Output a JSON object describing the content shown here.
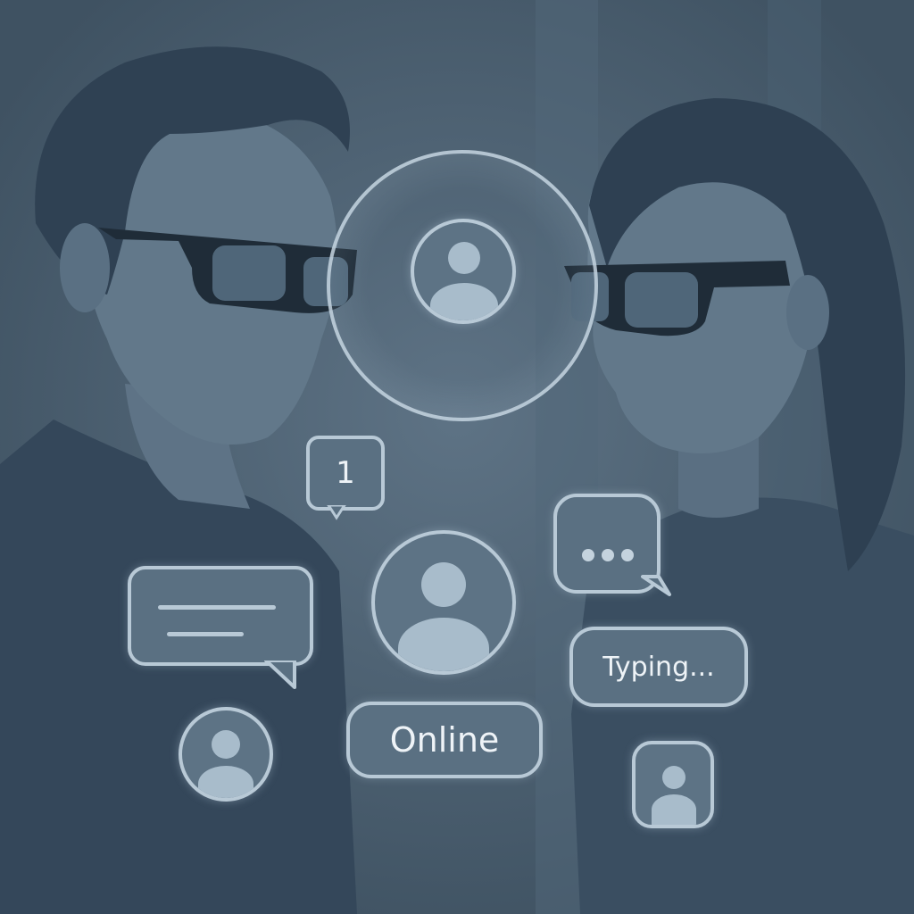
{
  "notification_badge": {
    "count": "1"
  },
  "status_pill": {
    "label": "Online"
  },
  "typing_pill": {
    "label": "Typing..."
  },
  "icons": [
    "user-avatar-icon",
    "message-bubble-icon",
    "ellipsis-bubble-icon",
    "notification-badge-icon"
  ],
  "colors": {
    "background": "#465a6b",
    "ui_fill": "#5a7082",
    "ui_outline": "#b8c9d6",
    "text": "#eef3f7"
  }
}
